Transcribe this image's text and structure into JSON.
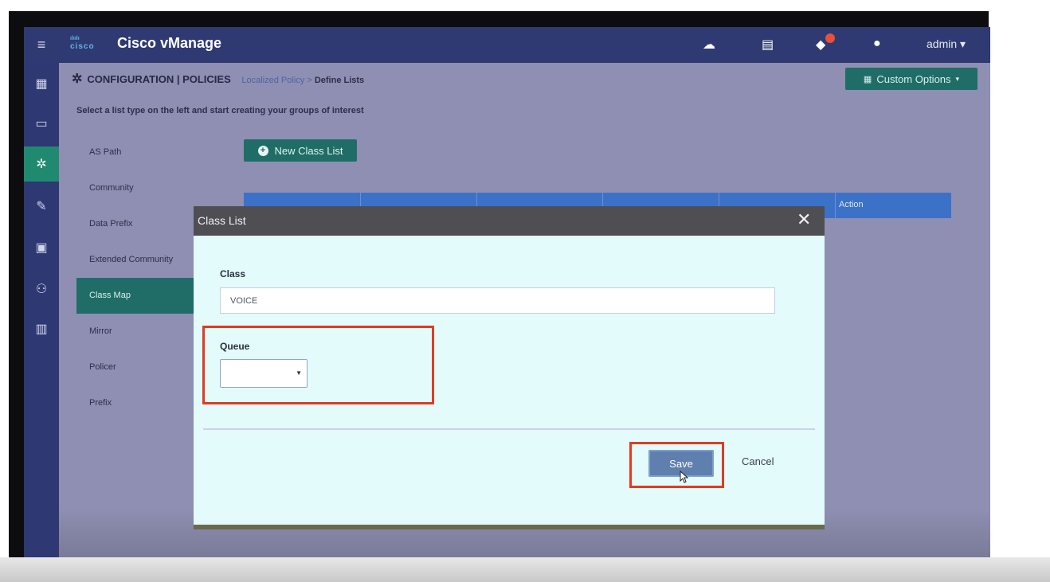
{
  "app": {
    "logo_text": "cisco",
    "title": "Cisco vManage",
    "user": "admin ▾"
  },
  "topbar_icons": [
    "cloud-icon",
    "clipboard-icon",
    "bell-icon",
    "help-icon"
  ],
  "rail_icons": [
    "dashboard-icon",
    "monitor-icon",
    "settings-icon",
    "tools-icon",
    "maintenance-icon",
    "admin-icon",
    "analytics-icon"
  ],
  "page": {
    "section": "CONFIGURATION | POLICIES",
    "breadcrumb_1": "Localized Policy",
    "breadcrumb_sep": ">",
    "breadcrumb_2": "Define Lists",
    "custom_options": "Custom Options",
    "instruction": "Select a list type on the left and start creating your groups of interest",
    "new_list_button": "New Class List"
  },
  "list_types": [
    {
      "label": "AS Path"
    },
    {
      "label": "Community"
    },
    {
      "label": "Data Prefix"
    },
    {
      "label": "Extended Community"
    },
    {
      "label": "Class Map",
      "active": true
    },
    {
      "label": "Mirror"
    },
    {
      "label": "Policer"
    },
    {
      "label": "Prefix"
    }
  ],
  "table": {
    "action_header": "Action"
  },
  "modal": {
    "title": "Class List",
    "class_label": "Class",
    "class_value": "VOICE",
    "queue_label": "Queue",
    "queue_value": "",
    "save": "Save",
    "cancel": "Cancel"
  },
  "colors": {
    "accent_teal": "#1f6d66",
    "topbar": "#2f3a72",
    "highlight_red": "#e33a1f"
  }
}
